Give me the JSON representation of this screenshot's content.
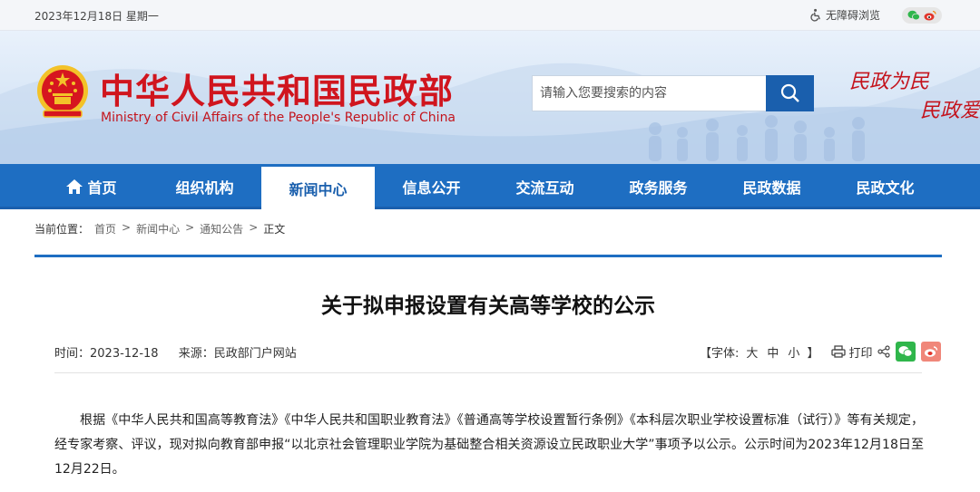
{
  "topbar": {
    "date": "2023年12月18日 星期一",
    "accessibility": "无障碍浏览"
  },
  "header": {
    "site_name_cn": "中华人民共和国民政部",
    "site_name_en": "Ministry of Civil Affairs of the People's Republic of China",
    "search_placeholder": "请输入您要搜索的内容",
    "slogan_line1": "民政为民",
    "slogan_line2": "民政爱"
  },
  "nav": {
    "items": [
      {
        "label": "首页"
      },
      {
        "label": "组织机构"
      },
      {
        "label": "新闻中心"
      },
      {
        "label": "信息公开"
      },
      {
        "label": "交流互动"
      },
      {
        "label": "政务服务"
      },
      {
        "label": "民政数据"
      },
      {
        "label": "民政文化"
      }
    ],
    "active_index": 2
  },
  "breadcrumb": {
    "prefix": "当前位置：",
    "items": [
      "首页",
      "新闻中心",
      "通知公告",
      "正文"
    ],
    "separator": ">"
  },
  "article": {
    "title": "关于拟申报设置有关高等学校的公示",
    "time_label": "时间：2023-12-18",
    "source_label": "来源：民政部门户网站",
    "font_label": "【字体:",
    "font_large": "大",
    "font_medium": "中",
    "font_small": "小",
    "font_close": "】",
    "print_label": "打印",
    "body": "根据《中华人民共和国高等教育法》《中华人民共和国职业教育法》《普通高等学校设置暂行条例》《本科层次职业学校设置标准（试行）》等有关规定，经专家考察、评议，现对拟向教育部申报“以北京社会管理职业学院为基础整合相关资源设立民政职业大学”事项予以公示。公示时间为2023年12月18日至12月22日。"
  },
  "colors": {
    "nav_blue": "#1e6ec2",
    "brand_red": "#d0151e",
    "wechat_green": "#2fb64b",
    "weibo_pink": "#f0877a"
  },
  "icons": [
    "wheelchair-icon",
    "wechat-icon",
    "weibo-icon",
    "national-emblem-icon",
    "search-icon",
    "home-icon",
    "print-icon",
    "share-icon"
  ]
}
